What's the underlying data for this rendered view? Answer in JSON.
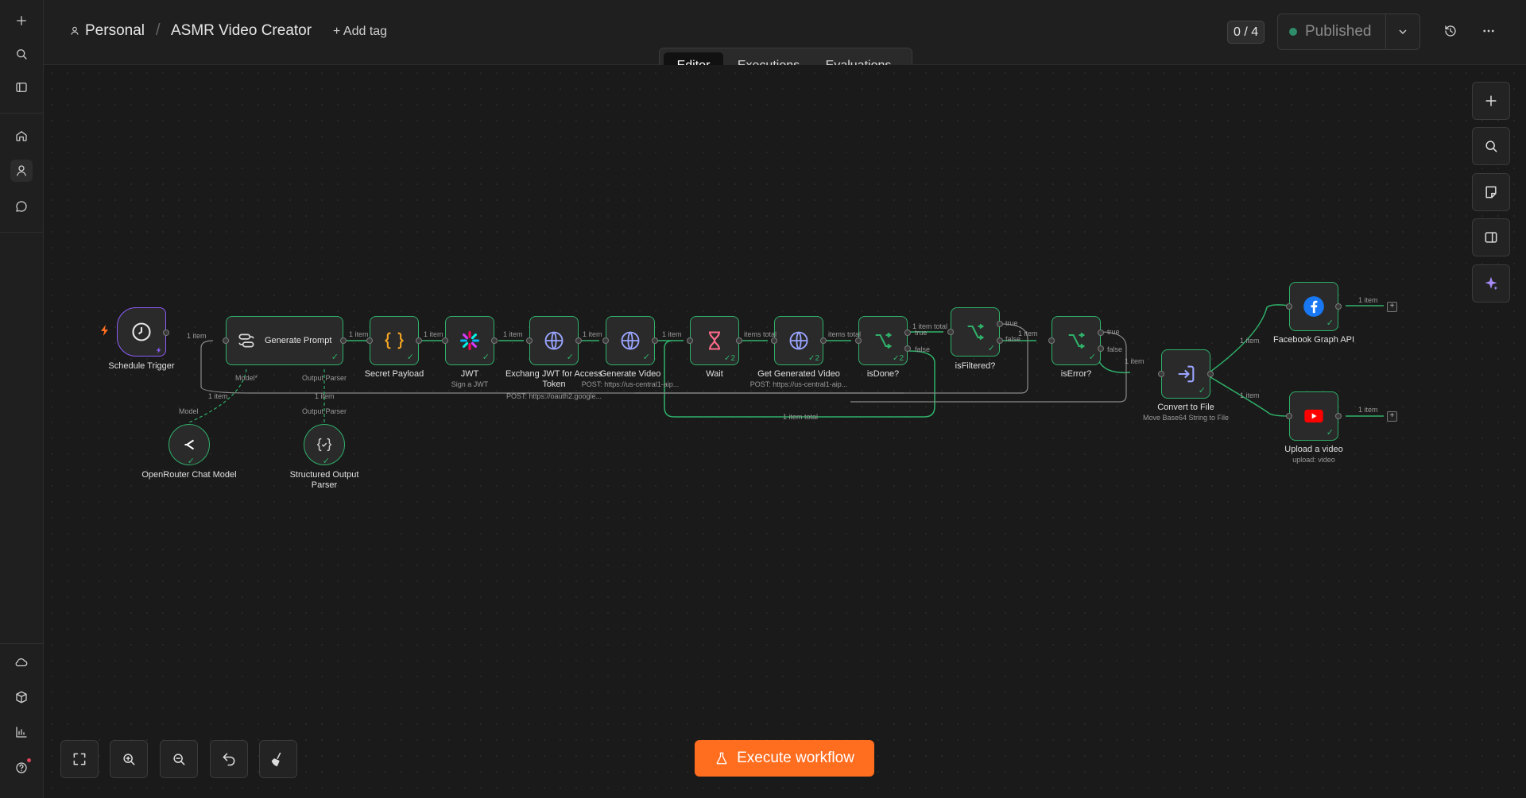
{
  "header": {
    "project": "Personal",
    "workflow_name": "ASMR Video Creator",
    "add_tag": "+ Add tag",
    "counter": "0 / 4",
    "status": "Published"
  },
  "tabs": [
    {
      "label": "Editor",
      "active": true
    },
    {
      "label": "Executions",
      "active": false
    },
    {
      "label": "Evaluations",
      "active": false
    }
  ],
  "nodes": {
    "schedule": {
      "label": "Schedule Trigger"
    },
    "generate_prompt": {
      "label": "Generate Prompt"
    },
    "secret": {
      "label": "Secret Payload"
    },
    "jwt": {
      "label": "JWT",
      "sub": "Sign a JWT"
    },
    "exchange": {
      "label": "Exchang JWT for Access Token",
      "sub": "POST: https://oauth2.google..."
    },
    "gen_video": {
      "label": "Generate Video",
      "sub": "POST: https://us-central1-aip..."
    },
    "wait": {
      "label": "Wait"
    },
    "get_video": {
      "label": "Get Generated Video",
      "sub": "POST: https://us-central1-aip..."
    },
    "isdone": {
      "label": "isDone?"
    },
    "isfiltered": {
      "label": "isFiltered?"
    },
    "iserror": {
      "label": "isError?"
    },
    "convert": {
      "label": "Convert to File",
      "sub": "Move Base64 String to File"
    },
    "facebook": {
      "label": "Facebook Graph API"
    },
    "youtube": {
      "label": "Upload a video",
      "sub": "upload: video"
    },
    "openrouter": {
      "label": "OpenRouter Chat Model"
    },
    "parser": {
      "label": "Structured Output Parser"
    }
  },
  "edge_labels": {
    "one_item": "1 item",
    "items_total": "items total",
    "one_item_total": "1 item total",
    "true": "true",
    "false": "false",
    "model": "Model",
    "model_req": "Model*",
    "output_parser": "Output Parser",
    "badge_2": "2"
  },
  "execute_button": "Execute workflow",
  "colors": {
    "accent": "#ff6d1f",
    "success": "#2fb16a",
    "trigger": "#8b5cf6",
    "background": "#1a1a1a"
  }
}
